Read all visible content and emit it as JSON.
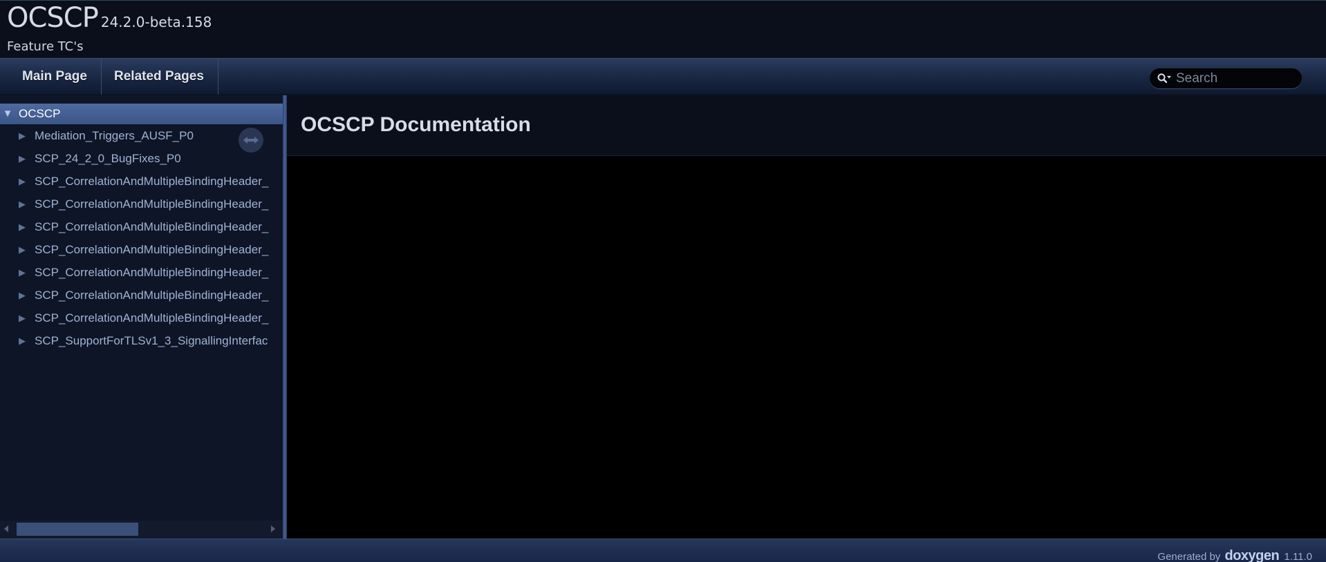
{
  "title_area": {
    "project_name": "OCSCP",
    "project_number": "24.2.0-beta.158",
    "project_brief": "Feature TC's"
  },
  "navbar": {
    "items": [
      {
        "label": "Main Page"
      },
      {
        "label": "Related Pages"
      }
    ],
    "search": {
      "placeholder": "Search",
      "value": ""
    }
  },
  "sidenav": {
    "root": {
      "label": "OCSCP",
      "expanded": true
    },
    "items": [
      {
        "label": "Mediation_Triggers_AUSF_P0"
      },
      {
        "label": "SCP_24_2_0_BugFixes_P0"
      },
      {
        "label": "SCP_CorrelationAndMultipleBindingHeader_"
      },
      {
        "label": "SCP_CorrelationAndMultipleBindingHeader_"
      },
      {
        "label": "SCP_CorrelationAndMultipleBindingHeader_"
      },
      {
        "label": "SCP_CorrelationAndMultipleBindingHeader_"
      },
      {
        "label": "SCP_CorrelationAndMultipleBindingHeader_"
      },
      {
        "label": "SCP_CorrelationAndMultipleBindingHeader_"
      },
      {
        "label": "SCP_CorrelationAndMultipleBindingHeader_"
      },
      {
        "label": "SCP_SupportForTLSv1_3_SignallingInterfac"
      }
    ]
  },
  "content": {
    "page_title": "OCSCP Documentation"
  },
  "footer": {
    "generated_by": "Generated by",
    "logo_text": "doxygen",
    "version": "1.11.0"
  },
  "icons": {
    "search": "search-icon",
    "sync": "sync-arrows-icon",
    "expanded": "triangle-down-icon",
    "collapsed": "triangle-right-icon"
  },
  "colors": {
    "background": "#000000",
    "title_area": "#0a0f1b",
    "sidenav": "#0e1526",
    "selected_row": "#4e6a9f",
    "link_text": "#9fb3d6"
  }
}
